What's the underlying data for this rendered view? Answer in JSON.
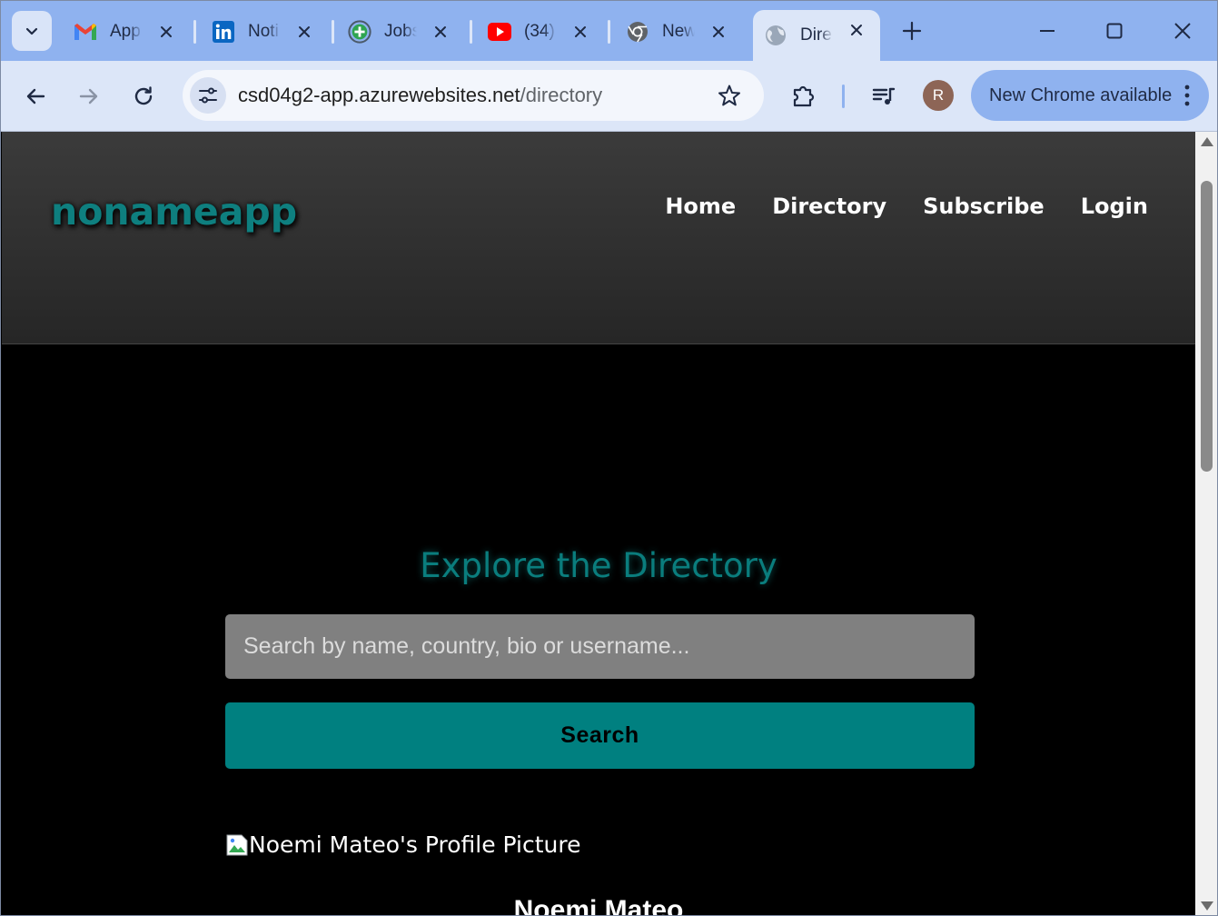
{
  "browser": {
    "tabs": [
      {
        "title": "App",
        "icon": "gmail-icon",
        "active": false
      },
      {
        "title": "Noti",
        "icon": "linkedin-icon",
        "active": false
      },
      {
        "title": "Jobs",
        "icon": "jobs-icon",
        "active": false
      },
      {
        "title": "(34)",
        "icon": "youtube-icon",
        "active": false
      },
      {
        "title": "New",
        "icon": "chrome-icon",
        "active": false
      },
      {
        "title": "Dire",
        "icon": "globe-icon",
        "active": true
      }
    ],
    "url_host": "csd04g2-app.azurewebsites.net",
    "url_path": "/directory",
    "profile_initial": "R",
    "update_label": "New Chrome available"
  },
  "site": {
    "logo": "nonameapp",
    "nav": [
      "Home",
      "Directory",
      "Subscribe",
      "Login"
    ]
  },
  "main": {
    "title": "Explore the Directory",
    "search_placeholder": "Search by name, country, bio or username...",
    "search_button": "Search",
    "profile": {
      "picture_alt": "Noemi Mateo's Profile Picture",
      "name": "Noemi Mateo"
    }
  },
  "colors": {
    "tabstrip": "#8fb2ef",
    "toolbar": "#dce6f8",
    "accent_teal": "#008080",
    "header_bg": "#333333",
    "page_bg": "#000000"
  }
}
